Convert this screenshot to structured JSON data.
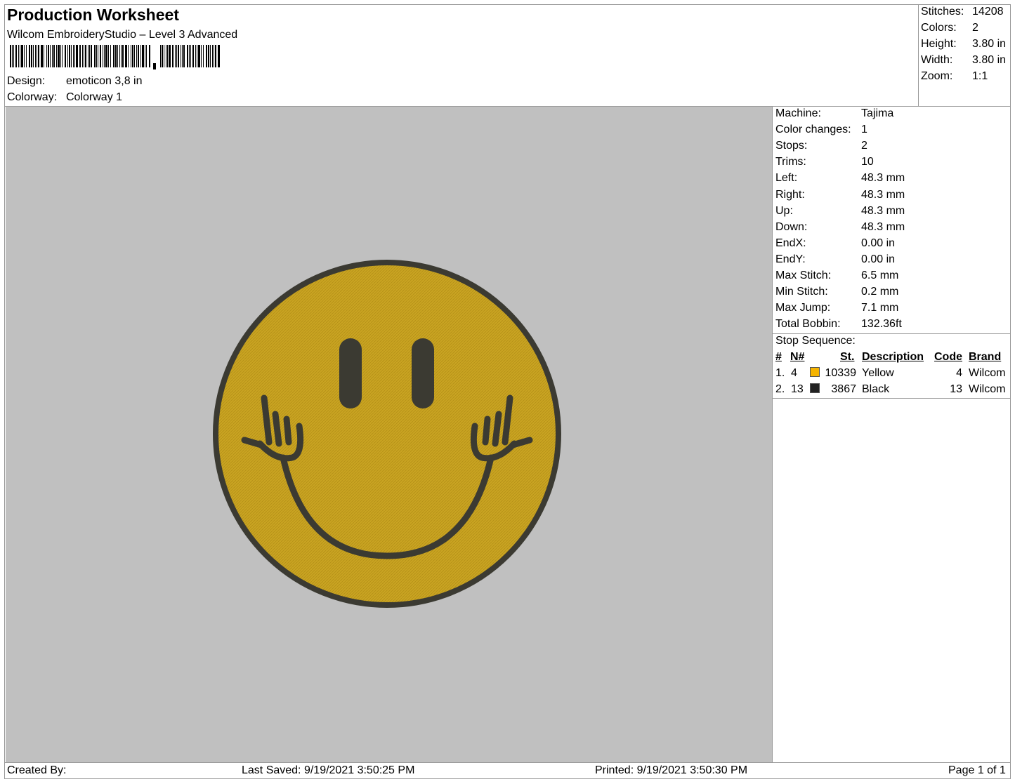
{
  "header": {
    "title": "Production Worksheet",
    "subtitle": "Wilcom EmbroideryStudio – Level 3 Advanced",
    "design_label": "Design:",
    "design_value": "emoticon 3,8 in",
    "colorway_label": "Colorway:",
    "colorway_value": "Colorway 1"
  },
  "stats": [
    {
      "label": "Stitches:",
      "value": "14208"
    },
    {
      "label": "Colors:",
      "value": "2"
    },
    {
      "label": "Height:",
      "value": "3.80 in"
    },
    {
      "label": "Width:",
      "value": "3.80 in"
    },
    {
      "label": "Zoom:",
      "value": "1:1"
    }
  ],
  "info": [
    {
      "label": "Machine:",
      "value": "Tajima"
    },
    {
      "label": "Color changes:",
      "value": "1"
    },
    {
      "label": "Stops:",
      "value": "2"
    },
    {
      "label": "Trims:",
      "value": "10"
    },
    {
      "label": "Left:",
      "value": "48.3 mm"
    },
    {
      "label": "Right:",
      "value": "48.3 mm"
    },
    {
      "label": "Up:",
      "value": "48.3 mm"
    },
    {
      "label": "Down:",
      "value": "48.3 mm"
    },
    {
      "label": "EndX:",
      "value": "0.00 in"
    },
    {
      "label": "EndY:",
      "value": "0.00 in"
    },
    {
      "label": "Max Stitch:",
      "value": "6.5 mm"
    },
    {
      "label": "Min Stitch:",
      "value": "0.2 mm"
    },
    {
      "label": "Max Jump:",
      "value": "7.1 mm"
    },
    {
      "label": "Total Bobbin:",
      "value": "132.36ft"
    }
  ],
  "stop_sequence": {
    "title": "Stop Sequence:",
    "headers": {
      "num": "#",
      "n": "N#",
      "st": "St.",
      "desc": "Description",
      "code": "Code",
      "brand": "Brand"
    },
    "rows": [
      {
        "num": "1.",
        "n": "4",
        "color": "#f5b400",
        "st": "10339",
        "desc": "Yellow",
        "code": "4",
        "brand": "Wilcom"
      },
      {
        "num": "2.",
        "n": "13",
        "color": "#222222",
        "st": "3867",
        "desc": "Black",
        "code": "13",
        "brand": "Wilcom"
      }
    ]
  },
  "footer": {
    "created_by": "Created By:",
    "last_saved": "Last Saved: 9/19/2021 3:50:25 PM",
    "printed": "Printed: 9/19/2021 3:50:30 PM",
    "page": "Page 1 of 1"
  },
  "colors": {
    "design_background": "#c0c0c0",
    "face_fill": "#c9a422",
    "outline": "#3b3a32"
  }
}
